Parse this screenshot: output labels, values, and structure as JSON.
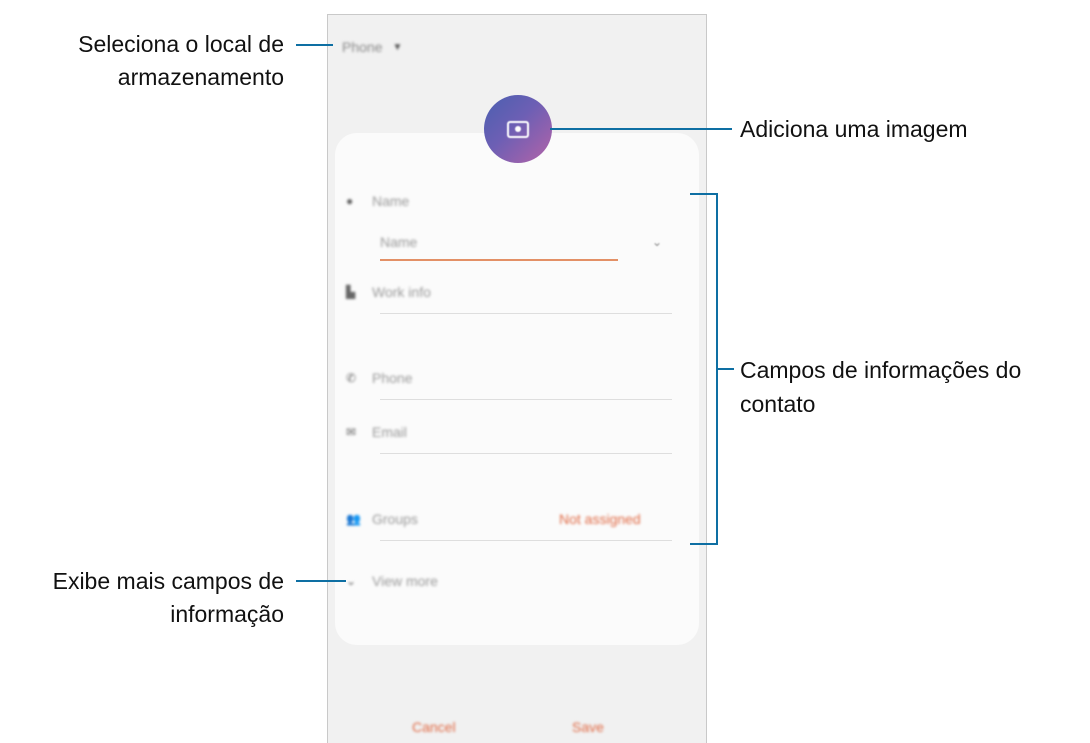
{
  "annotations": {
    "storage": "Seleciona o local de\narmazenamento",
    "storage_line1": "Seleciona o local de",
    "storage_line2": "armazenamento",
    "image": "Adiciona uma imagem",
    "fields_line1": "Campos de informações do",
    "fields_line2": "contato",
    "more_line1": "Exibe mais campos de",
    "more_line2": "informação"
  },
  "phone": {
    "storage_label": "Phone",
    "fields": {
      "name": "Name",
      "name_sub": "Name",
      "work": "Work info",
      "phone": "Phone",
      "email": "Email",
      "groups": "Groups",
      "groups_value": "Not assigned",
      "view_more": "View more"
    },
    "cancel": "Cancel",
    "save": "Save"
  },
  "colors": {
    "accent": "#e06a45",
    "callout": "#0e6fa3"
  },
  "icons": [
    "person-icon",
    "work-icon",
    "phone-icon",
    "email-icon",
    "groups-icon",
    "chevron-down-icon",
    "camera-icon",
    "dropdown-arrow-icon"
  ]
}
